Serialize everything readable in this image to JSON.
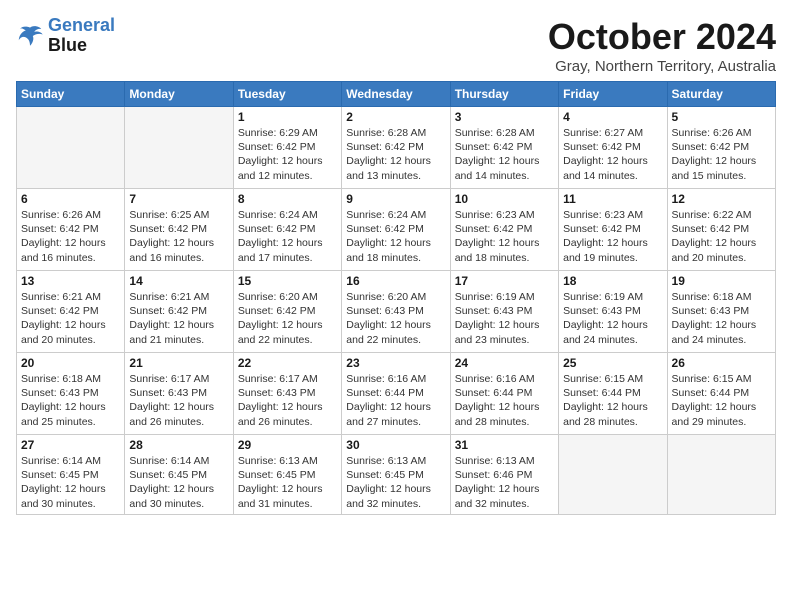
{
  "header": {
    "logo_line1": "General",
    "logo_line2": "Blue",
    "month_title": "October 2024",
    "subtitle": "Gray, Northern Territory, Australia"
  },
  "weekdays": [
    "Sunday",
    "Monday",
    "Tuesday",
    "Wednesday",
    "Thursday",
    "Friday",
    "Saturday"
  ],
  "weeks": [
    [
      {
        "day": "",
        "detail": ""
      },
      {
        "day": "",
        "detail": ""
      },
      {
        "day": "1",
        "detail": "Sunrise: 6:29 AM\nSunset: 6:42 PM\nDaylight: 12 hours\nand 12 minutes."
      },
      {
        "day": "2",
        "detail": "Sunrise: 6:28 AM\nSunset: 6:42 PM\nDaylight: 12 hours\nand 13 minutes."
      },
      {
        "day": "3",
        "detail": "Sunrise: 6:28 AM\nSunset: 6:42 PM\nDaylight: 12 hours\nand 14 minutes."
      },
      {
        "day": "4",
        "detail": "Sunrise: 6:27 AM\nSunset: 6:42 PM\nDaylight: 12 hours\nand 14 minutes."
      },
      {
        "day": "5",
        "detail": "Sunrise: 6:26 AM\nSunset: 6:42 PM\nDaylight: 12 hours\nand 15 minutes."
      }
    ],
    [
      {
        "day": "6",
        "detail": "Sunrise: 6:26 AM\nSunset: 6:42 PM\nDaylight: 12 hours\nand 16 minutes."
      },
      {
        "day": "7",
        "detail": "Sunrise: 6:25 AM\nSunset: 6:42 PM\nDaylight: 12 hours\nand 16 minutes."
      },
      {
        "day": "8",
        "detail": "Sunrise: 6:24 AM\nSunset: 6:42 PM\nDaylight: 12 hours\nand 17 minutes."
      },
      {
        "day": "9",
        "detail": "Sunrise: 6:24 AM\nSunset: 6:42 PM\nDaylight: 12 hours\nand 18 minutes."
      },
      {
        "day": "10",
        "detail": "Sunrise: 6:23 AM\nSunset: 6:42 PM\nDaylight: 12 hours\nand 18 minutes."
      },
      {
        "day": "11",
        "detail": "Sunrise: 6:23 AM\nSunset: 6:42 PM\nDaylight: 12 hours\nand 19 minutes."
      },
      {
        "day": "12",
        "detail": "Sunrise: 6:22 AM\nSunset: 6:42 PM\nDaylight: 12 hours\nand 20 minutes."
      }
    ],
    [
      {
        "day": "13",
        "detail": "Sunrise: 6:21 AM\nSunset: 6:42 PM\nDaylight: 12 hours\nand 20 minutes."
      },
      {
        "day": "14",
        "detail": "Sunrise: 6:21 AM\nSunset: 6:42 PM\nDaylight: 12 hours\nand 21 minutes."
      },
      {
        "day": "15",
        "detail": "Sunrise: 6:20 AM\nSunset: 6:42 PM\nDaylight: 12 hours\nand 22 minutes."
      },
      {
        "day": "16",
        "detail": "Sunrise: 6:20 AM\nSunset: 6:43 PM\nDaylight: 12 hours\nand 22 minutes."
      },
      {
        "day": "17",
        "detail": "Sunrise: 6:19 AM\nSunset: 6:43 PM\nDaylight: 12 hours\nand 23 minutes."
      },
      {
        "day": "18",
        "detail": "Sunrise: 6:19 AM\nSunset: 6:43 PM\nDaylight: 12 hours\nand 24 minutes."
      },
      {
        "day": "19",
        "detail": "Sunrise: 6:18 AM\nSunset: 6:43 PM\nDaylight: 12 hours\nand 24 minutes."
      }
    ],
    [
      {
        "day": "20",
        "detail": "Sunrise: 6:18 AM\nSunset: 6:43 PM\nDaylight: 12 hours\nand 25 minutes."
      },
      {
        "day": "21",
        "detail": "Sunrise: 6:17 AM\nSunset: 6:43 PM\nDaylight: 12 hours\nand 26 minutes."
      },
      {
        "day": "22",
        "detail": "Sunrise: 6:17 AM\nSunset: 6:43 PM\nDaylight: 12 hours\nand 26 minutes."
      },
      {
        "day": "23",
        "detail": "Sunrise: 6:16 AM\nSunset: 6:44 PM\nDaylight: 12 hours\nand 27 minutes."
      },
      {
        "day": "24",
        "detail": "Sunrise: 6:16 AM\nSunset: 6:44 PM\nDaylight: 12 hours\nand 28 minutes."
      },
      {
        "day": "25",
        "detail": "Sunrise: 6:15 AM\nSunset: 6:44 PM\nDaylight: 12 hours\nand 28 minutes."
      },
      {
        "day": "26",
        "detail": "Sunrise: 6:15 AM\nSunset: 6:44 PM\nDaylight: 12 hours\nand 29 minutes."
      }
    ],
    [
      {
        "day": "27",
        "detail": "Sunrise: 6:14 AM\nSunset: 6:45 PM\nDaylight: 12 hours\nand 30 minutes."
      },
      {
        "day": "28",
        "detail": "Sunrise: 6:14 AM\nSunset: 6:45 PM\nDaylight: 12 hours\nand 30 minutes."
      },
      {
        "day": "29",
        "detail": "Sunrise: 6:13 AM\nSunset: 6:45 PM\nDaylight: 12 hours\nand 31 minutes."
      },
      {
        "day": "30",
        "detail": "Sunrise: 6:13 AM\nSunset: 6:45 PM\nDaylight: 12 hours\nand 32 minutes."
      },
      {
        "day": "31",
        "detail": "Sunrise: 6:13 AM\nSunset: 6:46 PM\nDaylight: 12 hours\nand 32 minutes."
      },
      {
        "day": "",
        "detail": ""
      },
      {
        "day": "",
        "detail": ""
      }
    ]
  ]
}
